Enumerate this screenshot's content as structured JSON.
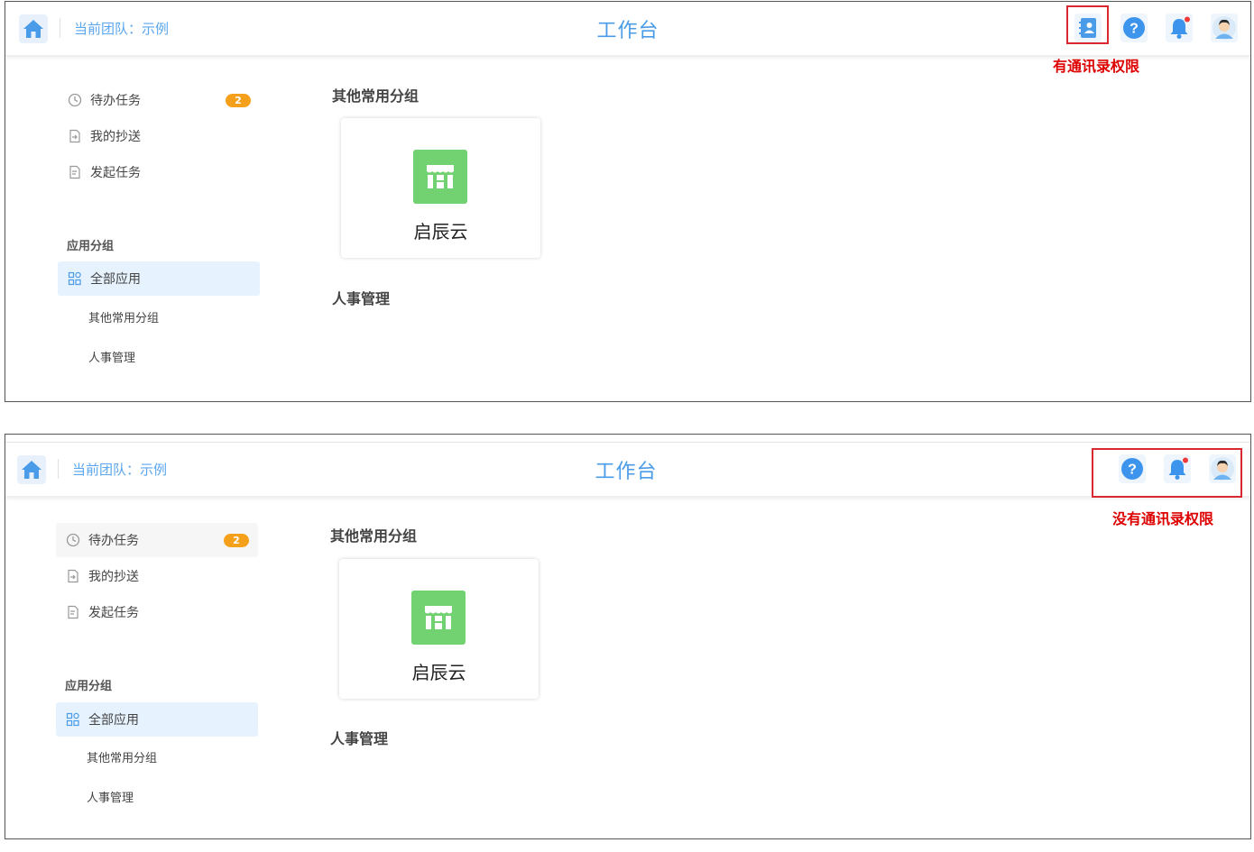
{
  "panels": [
    {
      "header": {
        "team_label": "当前团队：示例",
        "title": "工作台",
        "icons": [
          "contacts-icon",
          "help-icon",
          "bell-icon",
          "avatar-icon"
        ],
        "notification_dot": true
      },
      "annotation": "有通讯录权限",
      "sidebar": {
        "items": [
          {
            "label": "待办任务",
            "icon": "clock-icon",
            "badge": "2"
          },
          {
            "label": "我的抄送",
            "icon": "doc-forward-icon"
          },
          {
            "label": "发起任务",
            "icon": "doc-edit-icon"
          }
        ],
        "group_heading": "应用分组",
        "active_item": {
          "label": "全部应用",
          "icon": "grid-icon"
        },
        "sub_items": [
          "其他常用分组",
          "人事管理"
        ]
      },
      "main": {
        "sections": [
          {
            "title": "其他常用分组",
            "apps": [
              {
                "name": "启辰云",
                "icon": "store-icon",
                "color": "#72d171"
              }
            ]
          },
          {
            "title": "人事管理",
            "apps": []
          }
        ]
      }
    },
    {
      "header": {
        "team_label": "当前团队：示例",
        "title": "工作台",
        "icons": [
          "help-icon",
          "bell-icon",
          "avatar-icon"
        ],
        "notification_dot": true
      },
      "annotation": "没有通讯录权限",
      "sidebar": {
        "items": [
          {
            "label": "待办任务",
            "icon": "clock-icon",
            "badge": "2"
          },
          {
            "label": "我的抄送",
            "icon": "doc-forward-icon"
          },
          {
            "label": "发起任务",
            "icon": "doc-edit-icon"
          }
        ],
        "group_heading": "应用分组",
        "active_item": {
          "label": "全部应用",
          "icon": "grid-icon"
        },
        "sub_items": [
          "其他常用分组",
          "人事管理"
        ]
      },
      "main": {
        "sections": [
          {
            "title": "其他常用分组",
            "apps": [
              {
                "name": "启辰云",
                "icon": "store-icon",
                "color": "#72d171"
              }
            ]
          },
          {
            "title": "人事管理",
            "apps": []
          }
        ]
      }
    }
  ],
  "colors": {
    "accent": "#4a9be8",
    "annotation": "#d00000",
    "badge": "#f5a01a",
    "app_icon": "#72d171",
    "active_bg": "#e6f2fd"
  }
}
